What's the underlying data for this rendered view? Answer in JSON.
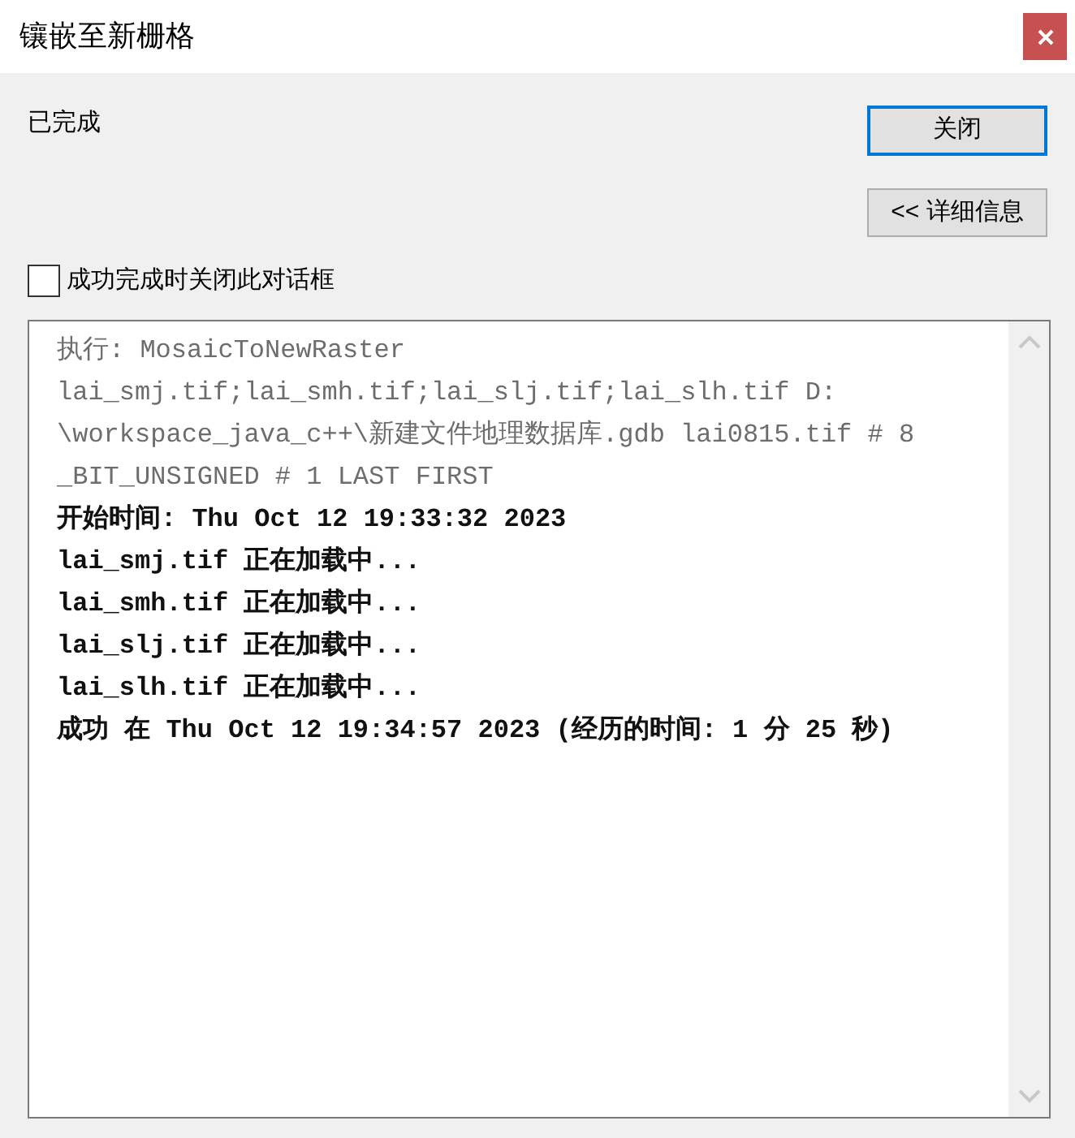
{
  "window": {
    "title": "镶嵌至新栅格"
  },
  "status": "已完成",
  "buttons": [
    {
      "label": "关闭",
      "kind": "default"
    },
    {
      "label": "<< 详细信息",
      "kind": "normal"
    }
  ],
  "close_on_success": {
    "label": "成功完成时关闭此对话框",
    "checked": false
  },
  "log": [
    {
      "text": "执行: MosaicToNewRaster",
      "kind": "command"
    },
    {
      "text": "lai_smj.tif;lai_smh.tif;lai_slj.tif;lai_slh.tif D:",
      "kind": "command"
    },
    {
      "text": "\\workspace_java_c++\\新建文件地理数据库.gdb lai0815.tif # 8",
      "kind": "command"
    },
    {
      "text": "_BIT_UNSIGNED # 1 LAST FIRST",
      "kind": "command"
    },
    {
      "text": "开始时间: Thu Oct 12 19:33:32 2023",
      "kind": "output"
    },
    {
      "text": "lai_smj.tif 正在加载中...",
      "kind": "output"
    },
    {
      "text": "lai_smh.tif 正在加载中...",
      "kind": "output"
    },
    {
      "text": "lai_slj.tif 正在加载中...",
      "kind": "output"
    },
    {
      "text": "lai_slh.tif 正在加载中...",
      "kind": "output"
    },
    {
      "text": "成功 在 Thu Oct 12 19:34:57 2023 (经历的时间: 1 分 25 秒)",
      "kind": "output"
    }
  ]
}
